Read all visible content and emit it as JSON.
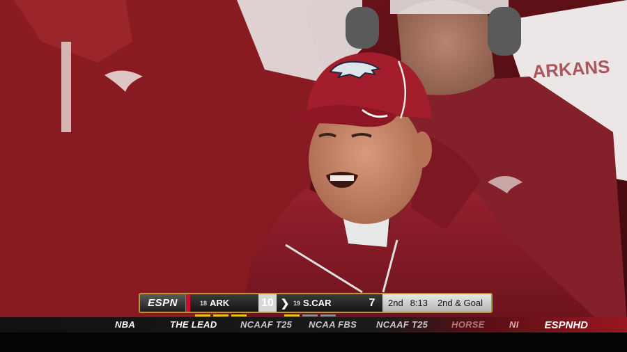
{
  "scoreboard": {
    "network": "ESPN",
    "team1": {
      "rank": "18",
      "abbr": "ARK",
      "score": "10"
    },
    "team2": {
      "rank": "19",
      "abbr": "S.CAR",
      "score": "7"
    },
    "quarter": "2nd",
    "clock": "8:13",
    "down_distance": "2nd & Goal",
    "colors": {
      "accent": "#c8102e",
      "gold": "#b09a3a"
    }
  },
  "ticker": {
    "items": [
      "NBA",
      "THE LEAD",
      "NCAAF T25",
      "NCAA FBS",
      "NCAAF T25",
      "HORSE",
      "NI"
    ],
    "logo": "ESPNHD"
  },
  "scene": {
    "cap_logo": "razorback-icon",
    "jacket_color": "#8e1a24",
    "background_color": "#6a1218"
  }
}
